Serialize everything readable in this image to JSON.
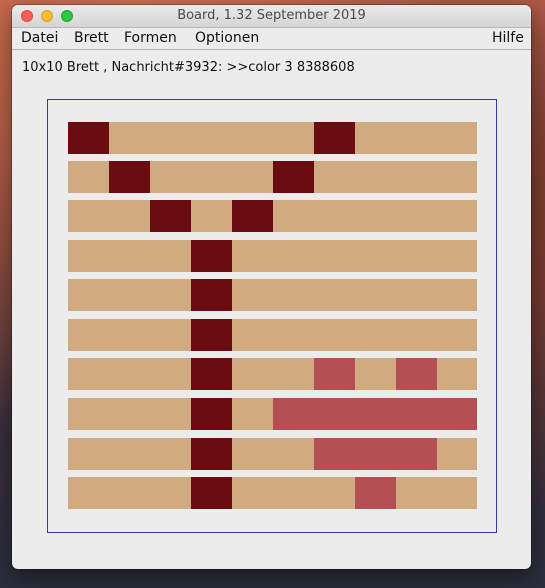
{
  "window": {
    "title": "Board, 1.32   September 2019"
  },
  "menubar": {
    "items": [
      "Datei",
      "Brett",
      "Formen",
      "Optionen"
    ],
    "help": "Hilfe"
  },
  "status_text": "10x10 Brett , Nachricht#3932: >>color 3 8388608",
  "colors": {
    "0": "#d1ab80",
    "1": "#6a0c10",
    "2": "#b44f54",
    "frame": "#2f3db5"
  },
  "board": {
    "rows": [
      [
        1,
        0,
        0,
        0,
        0,
        0,
        1,
        0,
        0,
        0
      ],
      [
        0,
        1,
        0,
        0,
        0,
        1,
        0,
        0,
        0,
        0
      ],
      [
        0,
        0,
        1,
        0,
        1,
        0,
        0,
        0,
        0,
        0
      ],
      [
        0,
        0,
        0,
        1,
        0,
        0,
        0,
        0,
        0,
        0
      ],
      [
        0,
        0,
        0,
        1,
        0,
        0,
        0,
        0,
        0,
        0
      ],
      [
        0,
        0,
        0,
        1,
        0,
        0,
        0,
        0,
        0,
        0
      ],
      [
        0,
        0,
        0,
        1,
        0,
        0,
        2,
        0,
        2,
        0
      ],
      [
        0,
        0,
        0,
        1,
        0,
        2,
        2,
        2,
        2,
        2
      ],
      [
        0,
        0,
        0,
        1,
        0,
        0,
        2,
        2,
        2,
        0
      ],
      [
        0,
        0,
        0,
        1,
        0,
        0,
        0,
        2,
        0,
        0
      ]
    ]
  }
}
